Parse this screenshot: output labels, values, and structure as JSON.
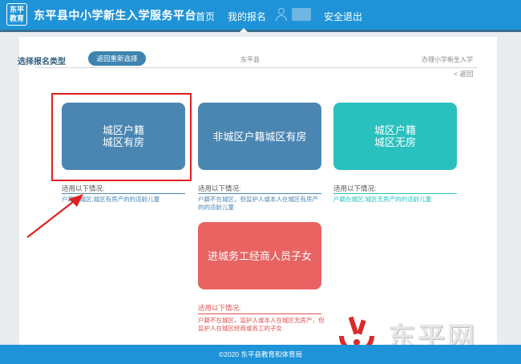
{
  "header": {
    "logo_line1": "东平",
    "logo_line2": "教育",
    "site_title": "东平县中小学新生入学服务平台",
    "nav_home": "首页",
    "nav_my_registration": "我的报名",
    "nav_logout": "安全退出",
    "user_icon": "user-icon"
  },
  "page": {
    "label_select_type": "选择报名类型",
    "btn_back_reselect": "返回重新选择",
    "county": "东平县",
    "school_type": "办理小学新生入学",
    "back_link": "< 返回"
  },
  "cards": [
    {
      "line1": "城区户籍",
      "line2": "城区有房",
      "color": "#4b86b3",
      "cond_title": "适用以下情况:",
      "cond_text": "户籍在城区,城区有房产的的适龄儿童"
    },
    {
      "line1": "非城区户籍城区有房",
      "line2": "",
      "color": "#4b86b3",
      "cond_title": "适用以下情况:",
      "cond_text": "户籍不在城区，但监护人或本人在城区有房产的的适龄儿童"
    },
    {
      "line1": "城区户籍",
      "line2": "城区无房",
      "color": "#29c0be",
      "cond_title": "适用以下情况:",
      "cond_text": "户籍在城区,城区无房产的的适龄儿童"
    },
    {
      "line1": "进城务工经商人员子女",
      "line2": "",
      "color": "#e96363",
      "cond_title": "适用以下情况:",
      "cond_text": "户籍不在城区，监护人或本人在城区无房产，但监护人在城区经商或务工的子女"
    }
  ],
  "footer": {
    "copyright": "©2020  东平县教育和体育局"
  },
  "watermark": {
    "text": "东平网",
    "logo_icon": "dongping-net-logo"
  },
  "colors": {
    "header_blue": "#1e93d8",
    "card_blue": "#4b86b3",
    "card_teal": "#29c0be",
    "card_red": "#e96363",
    "annotation_red": "#e02020"
  }
}
